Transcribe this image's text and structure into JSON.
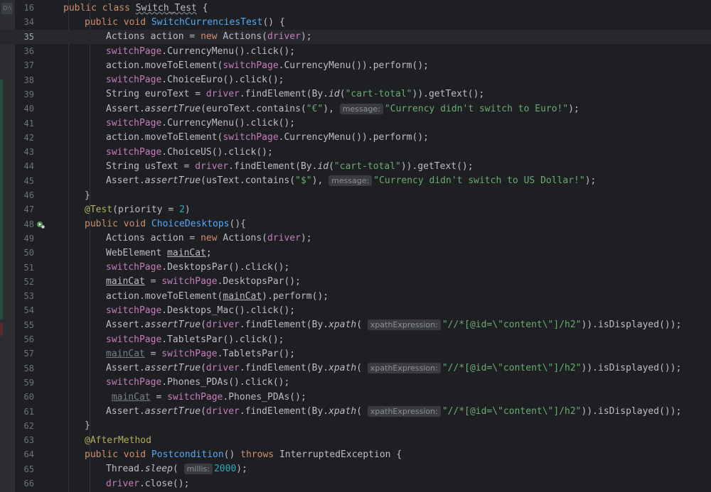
{
  "sidebar": {
    "chip": "D:\\"
  },
  "lines": [
    {
      "n": "16",
      "indent": 0,
      "tokens": [
        {
          "t": "public class ",
          "c": "kw"
        },
        {
          "t": "Switch_Test",
          "c": "wavy"
        },
        {
          "t": " {"
        }
      ]
    },
    {
      "n": "34",
      "indent": 1,
      "tokens": [
        {
          "t": "public void ",
          "c": "kw"
        },
        {
          "t": "SwitchCurrenciesTest",
          "c": "fn"
        },
        {
          "t": "() {"
        }
      ]
    },
    {
      "n": "35",
      "indent": 2,
      "current": true,
      "tokens": [
        {
          "t": "Actions action = "
        },
        {
          "t": "new ",
          "c": "kw"
        },
        {
          "t": "Actions("
        },
        {
          "t": "driver",
          "c": "fld"
        },
        {
          "t": ");"
        }
      ]
    },
    {
      "n": "36",
      "indent": 2,
      "tokens": [
        {
          "t": "switchPage",
          "c": "fld"
        },
        {
          "t": ".CurrencyMenu().click();"
        }
      ]
    },
    {
      "n": "37",
      "indent": 2,
      "tokens": [
        {
          "t": "action.moveToElement("
        },
        {
          "t": "switchPage",
          "c": "fld"
        },
        {
          "t": ".CurrencyMenu()).perform();"
        }
      ]
    },
    {
      "n": "38",
      "indent": 2,
      "tokens": [
        {
          "t": "switchPage",
          "c": "fld"
        },
        {
          "t": ".ChoiceEuro().click();"
        }
      ]
    },
    {
      "n": "39",
      "indent": 2,
      "tokens": [
        {
          "t": "String euroText = "
        },
        {
          "t": "driver",
          "c": "fld"
        },
        {
          "t": ".findElement(By."
        },
        {
          "t": "id",
          "c": "it"
        },
        {
          "t": "("
        },
        {
          "t": "\"cart-total\"",
          "c": "str"
        },
        {
          "t": ")).getText();"
        }
      ]
    },
    {
      "n": "40",
      "indent": 2,
      "tokens": [
        {
          "t": "Assert."
        },
        {
          "t": "assertTrue",
          "c": "it"
        },
        {
          "t": "(euroText.contains("
        },
        {
          "t": "\"€\"",
          "c": "str"
        },
        {
          "t": "), "
        },
        {
          "hint": "message:"
        },
        {
          "t": "\"Currency didn't switch to Euro!\"",
          "c": "str"
        },
        {
          "t": ");"
        }
      ]
    },
    {
      "n": "41",
      "indent": 2,
      "tokens": [
        {
          "t": "switchPage",
          "c": "fld"
        },
        {
          "t": ".CurrencyMenu().click();"
        }
      ]
    },
    {
      "n": "42",
      "indent": 2,
      "tokens": [
        {
          "t": "action.moveToElement("
        },
        {
          "t": "switchPage",
          "c": "fld"
        },
        {
          "t": ".CurrencyMenu()).perform();"
        }
      ]
    },
    {
      "n": "43",
      "indent": 2,
      "tokens": [
        {
          "t": "switchPage",
          "c": "fld"
        },
        {
          "t": ".ChoiceUS().click();"
        }
      ]
    },
    {
      "n": "44",
      "indent": 2,
      "tokens": [
        {
          "t": "String usText = "
        },
        {
          "t": "driver",
          "c": "fld"
        },
        {
          "t": ".findElement(By."
        },
        {
          "t": "id",
          "c": "it"
        },
        {
          "t": "("
        },
        {
          "t": "\"cart-total\"",
          "c": "str"
        },
        {
          "t": ")).getText();"
        }
      ]
    },
    {
      "n": "45",
      "indent": 2,
      "tokens": [
        {
          "t": "Assert."
        },
        {
          "t": "assertTrue",
          "c": "it"
        },
        {
          "t": "(usText.contains("
        },
        {
          "t": "\"$\"",
          "c": "str"
        },
        {
          "t": "), "
        },
        {
          "hint": "message:"
        },
        {
          "t": "\"Currency didn't switch to US Dollar!\"",
          "c": "str"
        },
        {
          "t": ");"
        }
      ]
    },
    {
      "n": "46",
      "indent": 1,
      "tokens": [
        {
          "t": "}"
        }
      ]
    },
    {
      "n": "47",
      "indent": 1,
      "tokens": [
        {
          "t": "@Test",
          "c": "ann"
        },
        {
          "t": "(priority = "
        },
        {
          "t": "2",
          "c": "num"
        },
        {
          "t": ")"
        }
      ]
    },
    {
      "n": "48",
      "indent": 1,
      "runIcon": true,
      "tokens": [
        {
          "t": "public void ",
          "c": "kw"
        },
        {
          "t": "ChoiceDesktops",
          "c": "fn"
        },
        {
          "t": "(){"
        }
      ]
    },
    {
      "n": "49",
      "indent": 2,
      "tokens": [
        {
          "t": "Actions action = "
        },
        {
          "t": "new ",
          "c": "kw"
        },
        {
          "t": "Actions("
        },
        {
          "t": "driver",
          "c": "fld"
        },
        {
          "t": ");"
        }
      ]
    },
    {
      "n": "50",
      "indent": 2,
      "tokens": [
        {
          "t": "WebElement "
        },
        {
          "t": "mainCat",
          "c": "ul"
        },
        {
          "t": ";"
        }
      ]
    },
    {
      "n": "51",
      "indent": 2,
      "tokens": [
        {
          "t": "switchPage",
          "c": "fld"
        },
        {
          "t": ".DesktopsPar().click();"
        }
      ]
    },
    {
      "n": "52",
      "indent": 2,
      "tokens": [
        {
          "t": "mainCat",
          "c": "ul"
        },
        {
          "t": " = "
        },
        {
          "t": "switchPage",
          "c": "fld"
        },
        {
          "t": ".DesktopsPar();"
        }
      ]
    },
    {
      "n": "53",
      "indent": 2,
      "tokens": [
        {
          "t": "action.moveToElement("
        },
        {
          "t": "mainCat",
          "c": "ul"
        },
        {
          "t": ").perform();"
        }
      ]
    },
    {
      "n": "54",
      "indent": 2,
      "tokens": [
        {
          "t": "switchPage",
          "c": "fld"
        },
        {
          "t": ".Desktops_Mac().click();"
        }
      ]
    },
    {
      "n": "55",
      "indent": 2,
      "tokens": [
        {
          "t": "Assert."
        },
        {
          "t": "assertTrue",
          "c": "it"
        },
        {
          "t": "("
        },
        {
          "t": "driver",
          "c": "fld"
        },
        {
          "t": ".findElement(By."
        },
        {
          "t": "xpath",
          "c": "it"
        },
        {
          "t": "( "
        },
        {
          "hint": "xpathExpression:"
        },
        {
          "t": "\"//*[@id=\\\"content\\\"]/h2\"",
          "c": "str"
        },
        {
          "t": ")).isDisplayed());"
        }
      ]
    },
    {
      "n": "56",
      "indent": 2,
      "tokens": [
        {
          "t": "switchPage",
          "c": "fld"
        },
        {
          "t": ".TabletsPar().click();"
        }
      ]
    },
    {
      "n": "57",
      "indent": 2,
      "tokens": [
        {
          "t": "mainCat",
          "c": "ul-dim"
        },
        {
          "t": " = "
        },
        {
          "t": "switchPage",
          "c": "fld"
        },
        {
          "t": ".TabletsPar();"
        }
      ]
    },
    {
      "n": "58",
      "indent": 2,
      "tokens": [
        {
          "t": "Assert."
        },
        {
          "t": "assertTrue",
          "c": "it"
        },
        {
          "t": "("
        },
        {
          "t": "driver",
          "c": "fld"
        },
        {
          "t": ".findElement(By."
        },
        {
          "t": "xpath",
          "c": "it"
        },
        {
          "t": "( "
        },
        {
          "hint": "xpathExpression:"
        },
        {
          "t": "\"//*[@id=\\\"content\\\"]/h2\"",
          "c": "str"
        },
        {
          "t": ")).isDisplayed());"
        }
      ]
    },
    {
      "n": "59",
      "indent": 2,
      "tokens": [
        {
          "t": "switchPage",
          "c": "fld"
        },
        {
          "t": ".Phones_PDAs().click();"
        }
      ]
    },
    {
      "n": "60",
      "indent": 2,
      "tokens": [
        {
          "t": " "
        },
        {
          "t": "mainCat",
          "c": "ul-dim"
        },
        {
          "t": " = "
        },
        {
          "t": "switchPage",
          "c": "fld"
        },
        {
          "t": ".Phones_PDAs();"
        }
      ]
    },
    {
      "n": "61",
      "indent": 2,
      "tokens": [
        {
          "t": "Assert."
        },
        {
          "t": "assertTrue",
          "c": "it"
        },
        {
          "t": "("
        },
        {
          "t": "driver",
          "c": "fld"
        },
        {
          "t": ".findElement(By."
        },
        {
          "t": "xpath",
          "c": "it"
        },
        {
          "t": "( "
        },
        {
          "hint": "xpathExpression:"
        },
        {
          "t": "\"//*[@id=\\\"content\\\"]/h2\"",
          "c": "str"
        },
        {
          "t": ")).isDisplayed());"
        }
      ]
    },
    {
      "n": "62",
      "indent": 1,
      "tokens": [
        {
          "t": "}"
        }
      ]
    },
    {
      "n": "63",
      "indent": 1,
      "tokens": [
        {
          "t": "@AfterMethod",
          "c": "ann"
        }
      ]
    },
    {
      "n": "64",
      "indent": 1,
      "tokens": [
        {
          "t": "public void ",
          "c": "kw"
        },
        {
          "t": "Postcondition",
          "c": "fn"
        },
        {
          "t": "() "
        },
        {
          "t": "throws ",
          "c": "kw"
        },
        {
          "t": "InterruptedException {"
        }
      ]
    },
    {
      "n": "65",
      "indent": 2,
      "tokens": [
        {
          "t": "Thread."
        },
        {
          "t": "sleep",
          "c": "it"
        },
        {
          "t": "( "
        },
        {
          "hint": "millis:"
        },
        {
          "t": "2000",
          "c": "num"
        },
        {
          "t": ");"
        }
      ]
    },
    {
      "n": "66",
      "indent": 2,
      "tokens": [
        {
          "t": "driver",
          "c": "fld"
        },
        {
          "t": ".close();"
        }
      ]
    }
  ]
}
